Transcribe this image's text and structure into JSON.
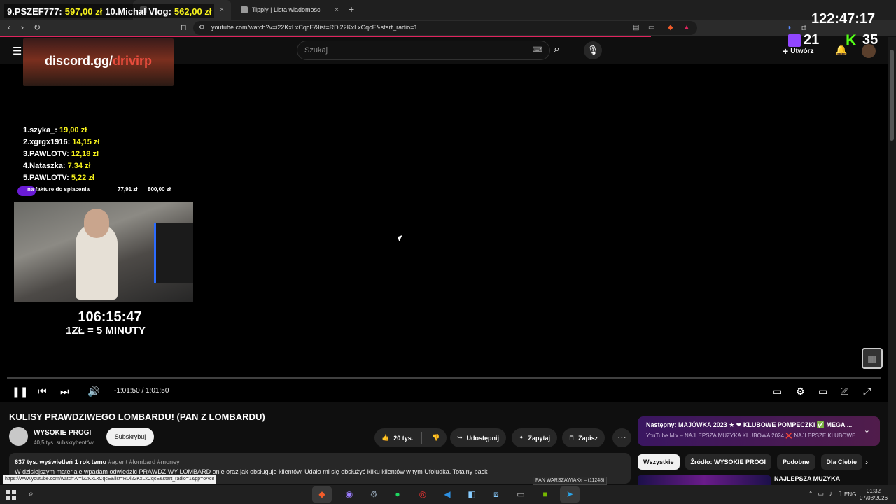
{
  "browser": {
    "tabs": [
      {
        "title": "",
        "active": true
      },
      {
        "title": "Tipply | Lista wiadomości",
        "active": false
      }
    ],
    "url": "youtube.com/watch?v=i22KxLxCqcE&list=RDi22KxLxCqcE&start_radio=1"
  },
  "yt_header": {
    "search_placeholder": "Szukaj",
    "create_label": "Utwórz"
  },
  "overlay": {
    "top_left_rank": "9.PSZEF777:",
    "top_left_amount": "597,00 zł",
    "top_left_rank2": "10.Michal Vlog:",
    "top_left_amount2": "562,00 zł",
    "clock": "122:47:17",
    "twitch_viewers": "21",
    "kick_viewers": "35",
    "discord_prefix": "discord.gg/",
    "discord_suffix": "drivirp",
    "donors": [
      {
        "rank": "1.szyka_:",
        "amount": "19,00 zł"
      },
      {
        "rank": "2.xgrgx1916:",
        "amount": "14,15 zł"
      },
      {
        "rank": "3.PAWLOTV:",
        "amount": "12,18 zł"
      },
      {
        "rank": "4.Nataszka:",
        "amount": "7,34 zł"
      },
      {
        "rank": "5.PAWLOTV:",
        "amount": "5,22 zł"
      }
    ],
    "goal_label": "na fakture do splacenia",
    "goal_current": "77,91 zł",
    "goal_target": "800,00 zł",
    "goal_progress": 0.097,
    "timer": "106:15:47",
    "rate": "1ZŁ = 5 MINUTY"
  },
  "player": {
    "time": "-1:01:50 / 1:01:50",
    "progress": 0.0
  },
  "video": {
    "title": "KULISY PRAWDZIWEGO LOMBARDU! (PAN Z LOMBARDU)",
    "channel": "WYSOKIE PROGI",
    "subscribers": "40,5 tys. subskrybentów",
    "subscribe_label": "Subskrybuj",
    "likes": "20 tys.",
    "share_label": "Udostępnij",
    "ask_label": "Zapytaj",
    "save_label": "Zapisz",
    "views": "637 tys. wyświetleń",
    "age": "1 rok temu",
    "tags": "#agent #lombard #money",
    "desc_line": "W dzisiejszym materiale wpadam odwiedzić PRAWDZIWY LOMBARD",
    "desc_line_rest": "onie oraz jak obsługuje klientów. Udało mi się obsłużyć kilku klientów w tym Ufoludka. Totalny back"
  },
  "sidebar": {
    "next_label": "Następny:",
    "next_title": "MAJÓWKA 2023 ★ ❤ KLUBOWE POMPECZKI ✅ MEGA ...",
    "next_sub": "YouTube Mix – NAJLEPSZA MUZYKA KLUBOWA 2024 ❌ NAJLEPSZE KLUBOWE ...",
    "chips": [
      "Wszystkie",
      "Źródło: WYSOKIE PROGI",
      "Podobne",
      "Dla Ciebie"
    ],
    "first_item_title": "NAJLEPSZA MUZYKA"
  },
  "status_bar": {
    "link": "https://www.youtube.com/watch?v=i22KxLxCqcE&list=RDi22KxLxCqcE&start_radio=1&pp=oAc8",
    "badge": "PAN WARSZAWIAK» – (11248)"
  },
  "taskbar": {
    "lang": "ENG",
    "time": "01:32",
    "date": "07/08/2026"
  },
  "colors": {
    "accent_red": "#e0245e",
    "amount_yellow": "#f7f31c",
    "twitch": "#9146ff",
    "kick": "#53fc18"
  }
}
